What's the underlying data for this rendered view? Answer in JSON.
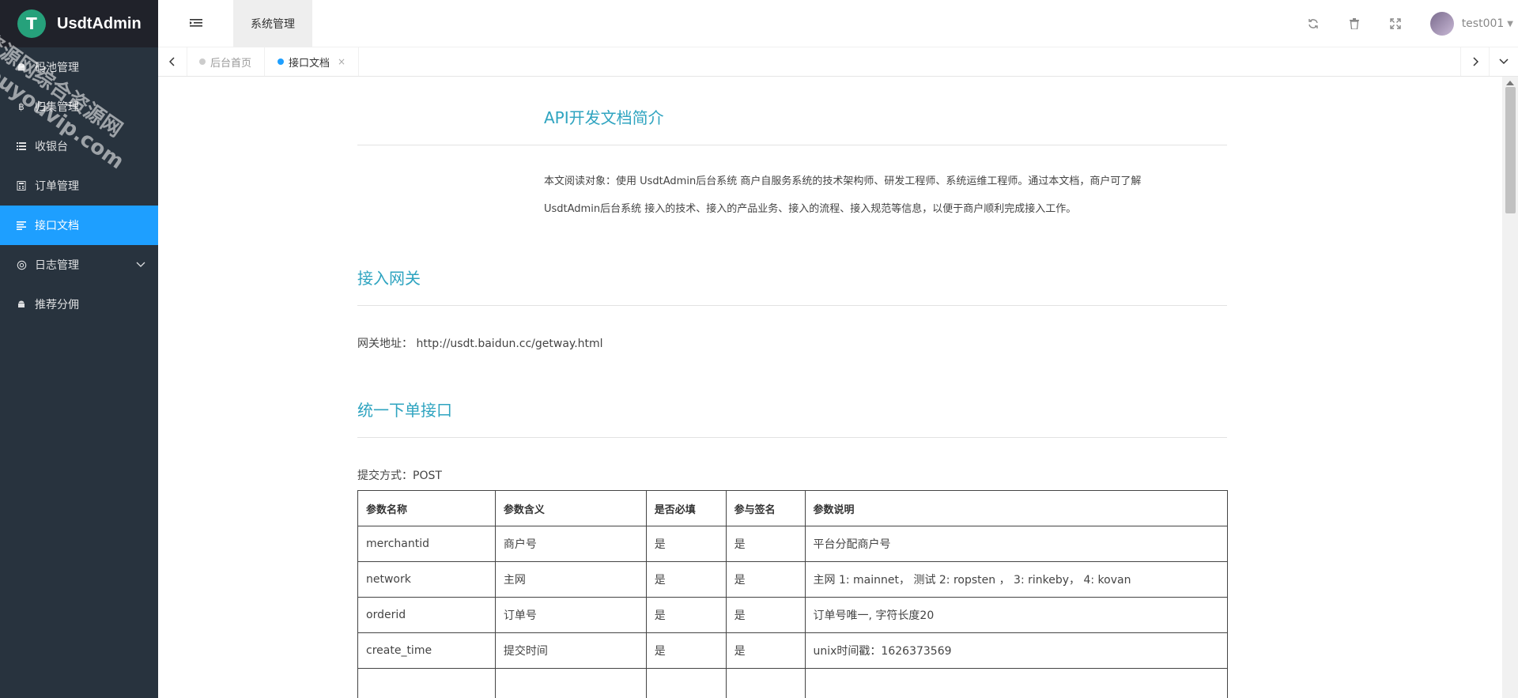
{
  "brand": {
    "logo_letter": "T",
    "name": "UsdtAdmin",
    "logo_color": "#26a17b"
  },
  "watermark": {
    "line1": "资源网综合资源网",
    "line2": "douyouvip.com"
  },
  "sidebar": {
    "items": [
      {
        "label": "码池管理",
        "icon": "android-icon"
      },
      {
        "label": "归集管理",
        "icon": "bitcoin-icon"
      },
      {
        "label": "收银台",
        "icon": "list-icon"
      },
      {
        "label": "订单管理",
        "icon": "calculator-icon"
      },
      {
        "label": "接口文档",
        "icon": "text-lines-icon",
        "active": true
      },
      {
        "label": "日志管理",
        "icon": "settings-icon",
        "expandable": true
      },
      {
        "label": "推荐分佣",
        "icon": "android-icon"
      }
    ],
    "active_color": "#1e9fff",
    "bg_color": "#28333e"
  },
  "header": {
    "top_tab": "系统管理",
    "user": "test001",
    "icons": [
      "refresh-icon",
      "trash-icon",
      "fullscreen-icon"
    ]
  },
  "tabs": [
    {
      "label": "后台首页",
      "active": false
    },
    {
      "label": "接口文档",
      "active": true,
      "closable": true,
      "close": "×"
    }
  ],
  "doc": {
    "title": "API开发文档简介",
    "intro": "本文阅读对象：使用 UsdtAdmin后台系统 商户自服务系统的技术架构师、研发工程师、系统运维工程师。通过本文档，商户可了解UsdtAdmin后台系统 接入的技术、接入的产品业务、接入的流程、接入规范等信息，以便于商户顺利完成接入工作。",
    "gateway_heading": "接入网关",
    "gateway_label": "网关地址：",
    "gateway_url": "http://usdt.baidun.cc/getway.html",
    "order_heading": "统一下单接口",
    "method": "提交方式：POST",
    "heading_color": "#2fa4c0"
  },
  "table": {
    "headers": [
      "参数名称",
      "参数含义",
      "是否必填",
      "参与签名",
      "参数说明"
    ],
    "rows": [
      [
        "merchantid",
        "商户号",
        "是",
        "是",
        "平台分配商户号"
      ],
      [
        "network",
        "主网",
        "是",
        "是",
        "主网 1: mainnet， 测试 2: ropsten ， 3: rinkeby， 4: kovan"
      ],
      [
        "orderid",
        "订单号",
        "是",
        "是",
        "订单号唯一, 字符长度20"
      ],
      [
        "create_time",
        "提交时间",
        "是",
        "是",
        "unix时间戳：1626373569"
      ],
      [
        "",
        "",
        "",
        "",
        ""
      ]
    ]
  }
}
